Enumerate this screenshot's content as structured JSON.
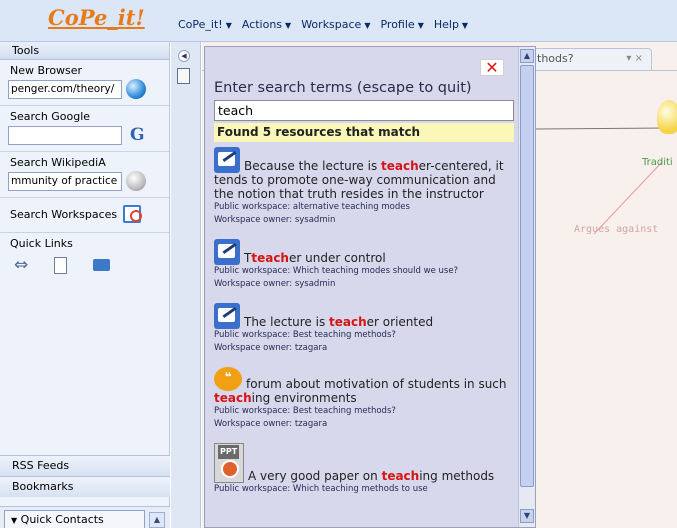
{
  "app": {
    "logo": "CoPe_it!",
    "menu": [
      "CoPe_it!",
      "Actions",
      "Workspace",
      "Profile",
      "Help"
    ]
  },
  "left_panel": {
    "tools_header": "Tools",
    "new_browser_label": "New Browser",
    "new_browser_value": "penger.com/theory/",
    "search_google_label": "Search Google",
    "search_google_value": "",
    "search_wikipedia_label": "Search WikipediA",
    "search_wikipedia_value": "mmunity of practice",
    "search_workspaces_label": "Search Workspaces",
    "quick_links_label": "Quick Links",
    "rss_feeds": "RSS Feeds",
    "bookmarks": "Bookmarks",
    "quick_contacts": "Quick Contacts"
  },
  "workspace": {
    "tab_label": "thods?",
    "node_label": "Traditi",
    "edge_label": "Argues against"
  },
  "search_dialog": {
    "title": "Enter search terms (escape to quit)",
    "query": "teach",
    "found_text": "Found 5 resources that match",
    "results": [
      {
        "icon": "note-icon",
        "title_before": "Because the lecture is ",
        "title_highlight": "teach",
        "title_after": "er-centered, it tends to promote one-way communication and the notion that truth resides in the instructor",
        "workspace": "Public workspace: alternative teaching modes",
        "owner": "Workspace owner: sysadmin"
      },
      {
        "icon": "note-icon",
        "title_before": "T",
        "title_highlight": "teach",
        "title_after": "er under control",
        "workspace": "Public workspace: Which teaching modes should we use?",
        "owner": "Workspace owner: sysadmin"
      },
      {
        "icon": "note-icon",
        "title_before": "The lecture is ",
        "title_highlight": "teach",
        "title_after": "er oriented",
        "workspace": "Public workspace: Best teaching methods?",
        "owner": "Workspace owner: tzagara"
      },
      {
        "icon": "quote-bubble-icon",
        "title_before": "forum about motivation of students in such ",
        "title_highlight": "teach",
        "title_after": "ing environments",
        "workspace": "Public workspace: Best teaching methods?",
        "owner": "Workspace owner: tzagara"
      },
      {
        "icon": "ppt-file-icon",
        "title_before": "A very good paper on ",
        "title_highlight": "teach",
        "title_after": "ing methods",
        "workspace": "Public workspace: Which teaching methods to use",
        "owner": ""
      }
    ]
  }
}
